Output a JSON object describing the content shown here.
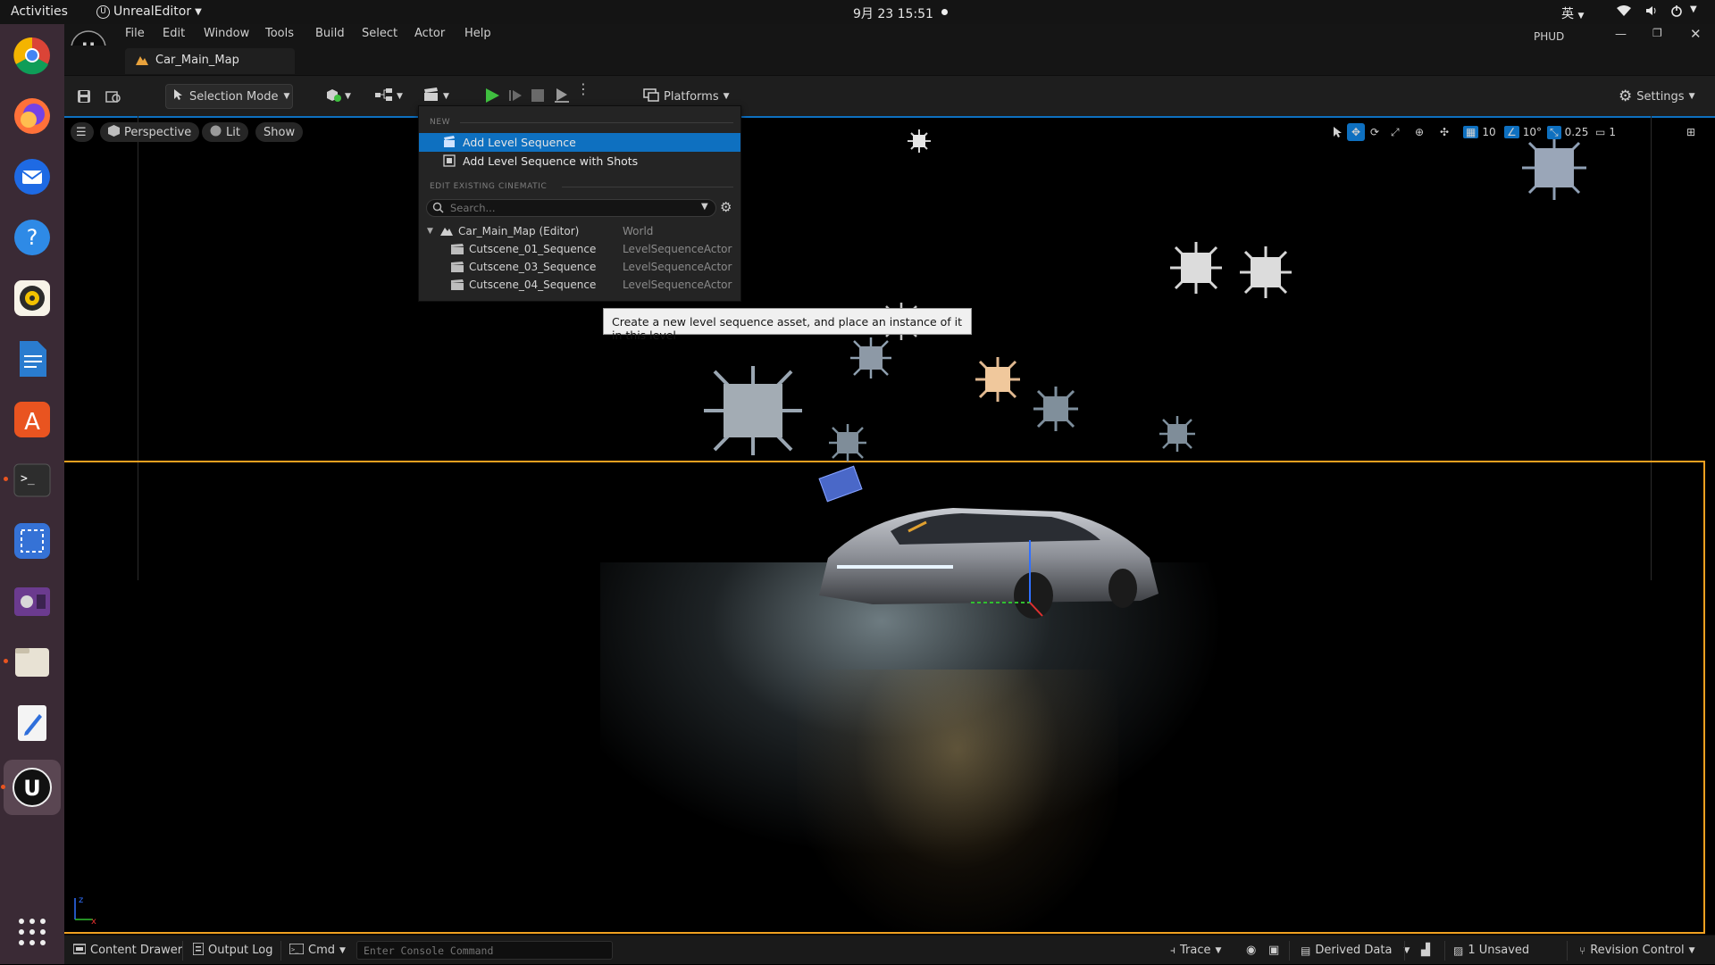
{
  "topbar": {
    "activities": "Activities",
    "app_name": "UnrealEditor",
    "clock": "9月 23  15:51",
    "input_method": "英"
  },
  "dock": {
    "items": [
      "chrome-icon",
      "firefox-icon",
      "thunderbird-icon",
      "help-icon",
      "rhythmbox-icon",
      "libreoffice-writer-icon",
      "app-center-icon",
      "terminal-icon",
      "screenshot-icon",
      "video-player-icon",
      "files-icon",
      "text-editor-icon",
      "unreal-engine-icon"
    ],
    "show_apps_icon": "apps-grid-icon"
  },
  "menubar": {
    "items": [
      "File",
      "Edit",
      "Window",
      "Tools",
      "Build",
      "Select",
      "Actor",
      "Help"
    ],
    "project": "PHUD"
  },
  "tab": {
    "label": "Car_Main_Map"
  },
  "toolbar": {
    "selection_mode": "Selection Mode",
    "platforms": "Platforms",
    "settings": "Settings"
  },
  "viewport": {
    "perspective": "Perspective",
    "lit": "Lit",
    "show": "Show",
    "grid_size": "10",
    "rotation_snap": "10°",
    "scale_snap": "0.25",
    "camera_speed": "1"
  },
  "cinematics_menu": {
    "section_new": "NEW",
    "add_level_sequence": "Add Level Sequence",
    "add_level_sequence_shots": "Add Level Sequence with Shots",
    "section_edit": "EDIT EXISTING CINEMATIC",
    "search_placeholder": "Search...",
    "tree": [
      {
        "name": "Car_Main_Map (Editor)",
        "type": "World"
      },
      {
        "name": "Cutscene_01_Sequence",
        "type": "LevelSequenceActor"
      },
      {
        "name": "Cutscene_03_Sequence",
        "type": "LevelSequenceActor"
      },
      {
        "name": "Cutscene_04_Sequence",
        "type": "LevelSequenceActor"
      }
    ]
  },
  "tooltip": "Create a new level sequence asset, and place an instance of it in this level",
  "statusbar": {
    "content_drawer": "Content Drawer",
    "output_log": "Output Log",
    "cmd": "Cmd",
    "console_placeholder": "Enter Console Command",
    "trace": "Trace",
    "derived_data": "Derived Data",
    "unsaved": "1 Unsaved",
    "revision_control": "Revision Control"
  },
  "colors": {
    "accent_blue": "#0e70c0",
    "play_green": "#3fbf3f",
    "selection_orange": "#f0a020"
  }
}
